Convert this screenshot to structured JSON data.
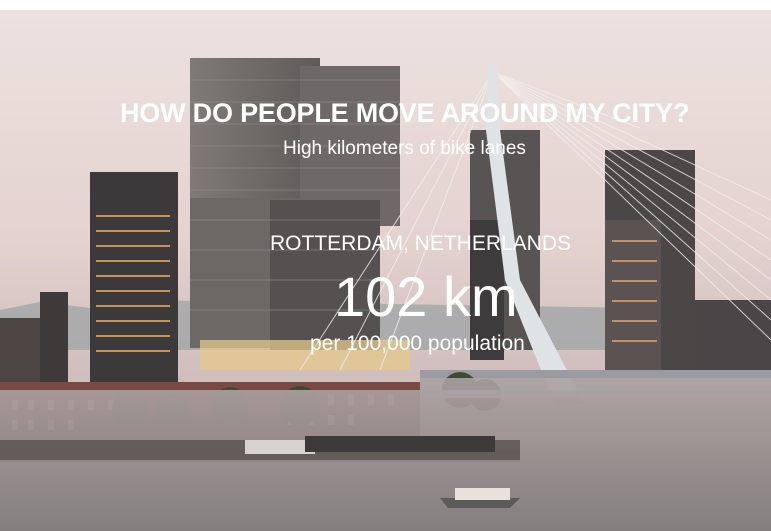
{
  "slide": {
    "headline": "HOW DO PEOPLE MOVE AROUND MY CITY?",
    "subheadline": "High kilometers of bike lanes",
    "location": "ROTTERDAM, NETHERLANDS",
    "stat_value": "102 km",
    "stat_unit": "per 100,000 population"
  },
  "colors": {
    "text": "#ffffff",
    "sky_top": "#e7dcda",
    "sky_bottom": "#c9b9b8",
    "water": "#8d8585"
  }
}
